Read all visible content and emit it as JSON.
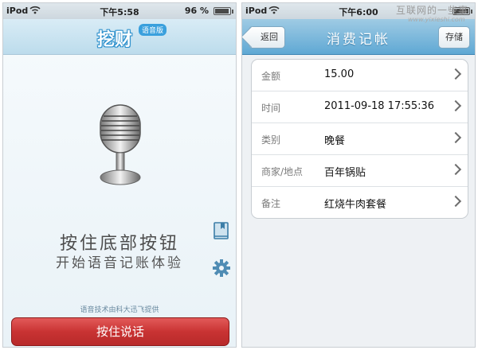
{
  "screens": {
    "left": {
      "status": {
        "carrier": "iPod",
        "time": "下午5:58",
        "battery": "96 %",
        "battery_level": 0.96
      },
      "header": {
        "logo": "挖财",
        "logo_badge": "语音版"
      },
      "icons": {
        "microphone": "microphone-icon",
        "book": "book-icon",
        "settings": "gear-icon"
      },
      "hint_line1": "按住底部按钮",
      "hint_line2": "开始语音记账体验",
      "provider": "语音技术由科大迅飞提供",
      "voice_button": "按住说话"
    },
    "right": {
      "status": {
        "carrier": "iPod",
        "time": "下午6:00",
        "battery_level": 1.0
      },
      "header": {
        "back": "返回",
        "title": "消费记帐",
        "save": "存储"
      },
      "rows": [
        {
          "label": "金额",
          "value": "15.00"
        },
        {
          "label": "时间",
          "value": "2011-09-18 17:55:36"
        },
        {
          "label": "类别",
          "value": "晚餐"
        },
        {
          "label": "商家/地点",
          "value": "百年锅贴"
        },
        {
          "label": "备注",
          "value": "红烧牛肉套餐"
        }
      ]
    }
  },
  "watermark": {
    "text": "互联网的一些事",
    "url": "www.yixieshi.com"
  },
  "colors": {
    "voice_button": "#c93333",
    "header_blue": "#5fa8d4",
    "logo_blue": "#2b8fcc"
  }
}
